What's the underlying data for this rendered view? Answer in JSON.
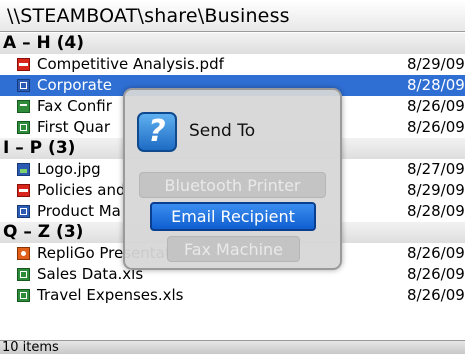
{
  "path": "\\\\STEAMBOAT\\share\\Business",
  "groups": [
    {
      "label": "A – H",
      "count": "(4)",
      "files": [
        {
          "name": "Competitive Analysis.pdf",
          "date": "8/29/09",
          "icon": "pdf-icon",
          "selected": false
        },
        {
          "name": "Corporate",
          "date": "8/28/09",
          "icon": "doc-icon",
          "selected": true
        },
        {
          "name": "Fax Confir",
          "date": "8/26/09",
          "icon": "fax-icon",
          "selected": false
        },
        {
          "name": "First Quar",
          "date": "8/26/09",
          "icon": "xls-icon",
          "selected": false
        }
      ]
    },
    {
      "label": "I – P",
      "count": "(3)",
      "files": [
        {
          "name": "Logo.jpg",
          "date": "8/27/09",
          "icon": "image-icon",
          "selected": false
        },
        {
          "name": "Policies and",
          "date": "8/29/09",
          "icon": "pdf-icon",
          "selected": false
        },
        {
          "name": "Product Ma",
          "date": "8/28/09",
          "icon": "doc-icon",
          "selected": false
        }
      ]
    },
    {
      "label": "Q – Z",
      "count": "(3)",
      "files": [
        {
          "name": "RepliGo Presentation.ppt",
          "date": "8/26/09",
          "icon": "ppt-icon",
          "selected": false
        },
        {
          "name": "Sales Data.xls",
          "date": "8/26/09",
          "icon": "xls-icon",
          "selected": false
        },
        {
          "name": "Travel Expenses.xls",
          "date": "8/26/09",
          "icon": "xls-icon",
          "selected": false
        }
      ]
    }
  ],
  "status": "10 items",
  "dialog": {
    "title": "Send To",
    "icon": "send-to-app-icon",
    "options": [
      {
        "label": "Bluetooth Printer",
        "state": "disabled"
      },
      {
        "label": "Email Recipient",
        "state": "focused"
      },
      {
        "label": "Fax Machine",
        "state": "disabled"
      }
    ]
  },
  "colors": {
    "selection": "#2f6fd4",
    "focus_button": "#1e6fe0"
  }
}
